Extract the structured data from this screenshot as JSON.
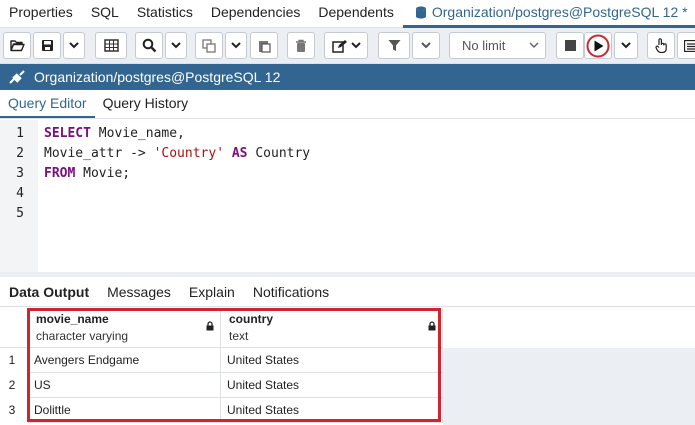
{
  "top_tabs": [
    "Properties",
    "SQL",
    "Statistics",
    "Dependencies",
    "Dependents"
  ],
  "active_tab": "Organization/postgres@PostgreSQL 12 *",
  "toolbar": {
    "limit_label": "No limit"
  },
  "connection": {
    "label": "Organization/postgres@PostgreSQL 12"
  },
  "editor_tabs": {
    "query_editor": "Query Editor",
    "query_history": "Query History"
  },
  "editor": {
    "line_numbers": [
      "1",
      "2",
      "3",
      "4",
      "5"
    ],
    "lines": [
      [
        {
          "t": "SELECT",
          "k": "kw"
        },
        {
          "t": " Movie_name,",
          "k": ""
        }
      ],
      [
        {
          "t": "Movie_attr -> ",
          "k": ""
        },
        {
          "t": "'Country'",
          "k": "str"
        },
        {
          "t": " ",
          "k": ""
        },
        {
          "t": "AS",
          "k": "kw"
        },
        {
          "t": " Country",
          "k": ""
        }
      ],
      [
        {
          "t": "FROM",
          "k": "kw"
        },
        {
          "t": " Movie;",
          "k": ""
        }
      ],
      [],
      []
    ]
  },
  "result_tabs": {
    "data_output": "Data Output",
    "messages": "Messages",
    "explain": "Explain",
    "notifications": "Notifications"
  },
  "grid": {
    "columns": [
      {
        "name": "movie_name",
        "type": "character varying"
      },
      {
        "name": "country",
        "type": "text"
      }
    ],
    "rows": [
      {
        "num": "1",
        "cells": [
          "Avengers Endgame",
          "United States"
        ]
      },
      {
        "num": "2",
        "cells": [
          "US",
          "United States"
        ]
      },
      {
        "num": "3",
        "cells": [
          "Dolittle",
          "United States"
        ]
      }
    ]
  },
  "colors": {
    "accent": "#326690",
    "highlight": "#d1242f",
    "keyword": "#7b0f80",
    "string": "#aa1111"
  }
}
